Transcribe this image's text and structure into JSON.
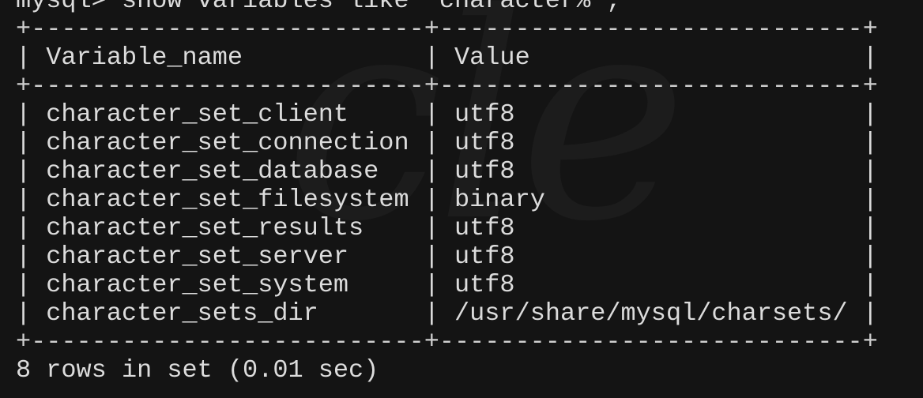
{
  "terminal": {
    "prompt_line": "mysql> show variables like 'character%';",
    "headers": {
      "variable": "Variable_name",
      "value": "Value"
    },
    "rows": [
      {
        "name": "character_set_client",
        "value": "utf8"
      },
      {
        "name": "character_set_connection",
        "value": "utf8"
      },
      {
        "name": "character_set_database",
        "value": "utf8"
      },
      {
        "name": "character_set_filesystem",
        "value": "binary"
      },
      {
        "name": "character_set_results",
        "value": "utf8"
      },
      {
        "name": "character_set_server",
        "value": "utf8"
      },
      {
        "name": "character_set_system",
        "value": "utf8"
      },
      {
        "name": "character_sets_dir",
        "value": "/usr/share/mysql/charsets/"
      }
    ],
    "summary": "8 rows in set (0.01 sec)",
    "colors": {
      "background": "#141414",
      "text": "#dcdcdc"
    }
  }
}
